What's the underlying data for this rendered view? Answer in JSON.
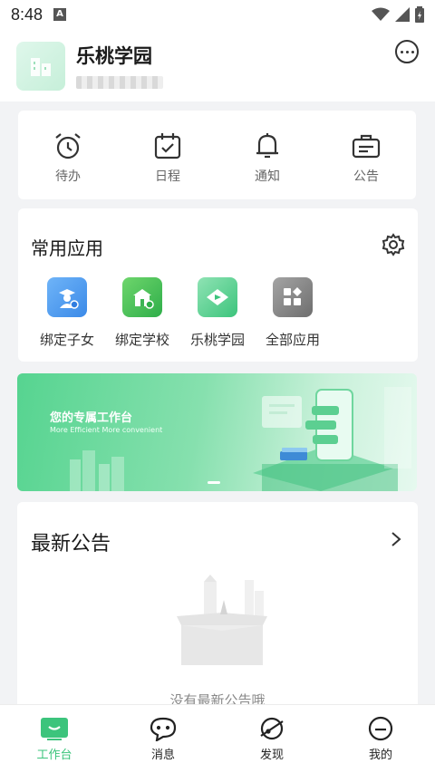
{
  "status_bar": {
    "time": "8:48",
    "notification_icon": "A"
  },
  "header": {
    "org_name": "乐桃学园"
  },
  "quick_actions": [
    {
      "label": "待办",
      "icon": "alarm-clock-icon"
    },
    {
      "label": "日程",
      "icon": "calendar-check-icon"
    },
    {
      "label": "通知",
      "icon": "bell-icon"
    },
    {
      "label": "公告",
      "icon": "ticket-icon"
    }
  ],
  "common_apps": {
    "title": "常用应用",
    "items": [
      {
        "label": "绑定子女",
        "icon": "bind-child-icon",
        "color": "#4a9cf0"
      },
      {
        "label": "绑定学校",
        "icon": "bind-school-icon",
        "color": "#44c15d"
      },
      {
        "label": "乐桃学园",
        "icon": "letao-logo-icon",
        "color": "#39c27a"
      },
      {
        "label": "全部应用",
        "icon": "all-apps-icon",
        "color": "#7c7c7c"
      }
    ]
  },
  "banner": {
    "title": "您的专属工作台",
    "subtitle": "More Efficient  More convenient"
  },
  "latest_notice": {
    "title": "最新公告",
    "empty_text": "没有最新公告哦"
  },
  "tabbar": [
    {
      "label": "工作台",
      "icon": "workbench-icon",
      "active": true
    },
    {
      "label": "消息",
      "icon": "chat-bubble-icon",
      "active": false
    },
    {
      "label": "发现",
      "icon": "planet-icon",
      "active": false
    },
    {
      "label": "我的",
      "icon": "profile-icon",
      "active": false
    }
  ],
  "colors": {
    "accent": "#3cc47c"
  }
}
